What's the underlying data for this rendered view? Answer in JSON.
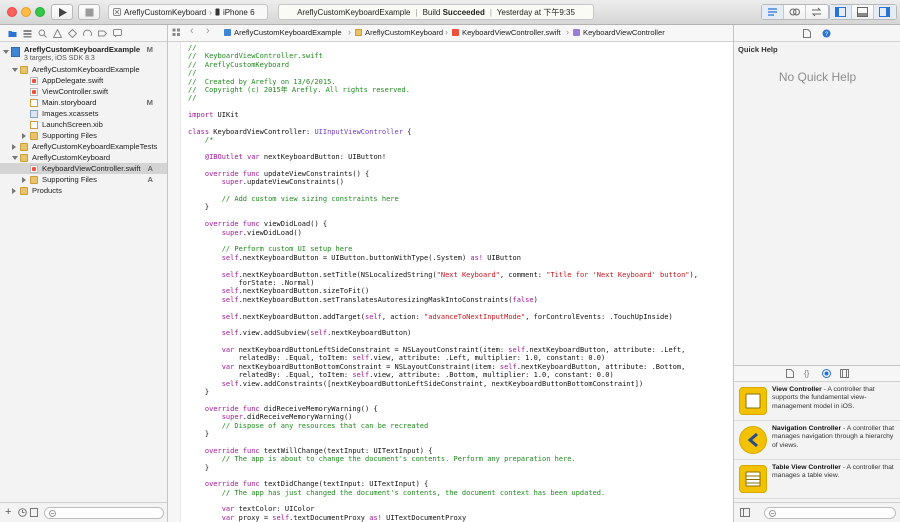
{
  "toolbar": {
    "scheme_target": "AreflyCustomKeyboard",
    "scheme_device": "iPhone 6",
    "status_project": "AreflyCustomKeyboardExample",
    "status_build_prefix": "Build",
    "status_build_result": "Succeeded",
    "status_time": "Yesterday at 下午9:35"
  },
  "navigator": {
    "project_name": "AreflyCustomKeyboardExample",
    "project_meta": "3 targets, iOS SDK 8.3",
    "project_badge": "M",
    "items": [
      {
        "label": "AreflyCustomKeyboardExample",
        "badge": ""
      },
      {
        "label": "AppDelegate.swift",
        "badge": ""
      },
      {
        "label": "ViewController.swift",
        "badge": ""
      },
      {
        "label": "Main.storyboard",
        "badge": "M"
      },
      {
        "label": "Images.xcassets",
        "badge": ""
      },
      {
        "label": "LaunchScreen.xib",
        "badge": ""
      },
      {
        "label": "Supporting Files",
        "badge": ""
      },
      {
        "label": "AreflyCustomKeyboardExampleTests",
        "badge": ""
      },
      {
        "label": "AreflyCustomKeyboard",
        "badge": ""
      },
      {
        "label": "KeyboardViewController.swift",
        "badge": "A"
      },
      {
        "label": "Supporting Files",
        "badge": "A"
      },
      {
        "label": "Products",
        "badge": ""
      }
    ]
  },
  "jumpbar": {
    "crumbs": [
      "AreflyCustomKeyboardExample",
      "AreflyCustomKeyboard",
      "KeyboardViewController.swift",
      "KeyboardViewController"
    ]
  },
  "code": {
    "lines": [
      [
        [
          "c",
          "//"
        ]
      ],
      [
        [
          "c",
          "//  KeyboardViewController.swift"
        ]
      ],
      [
        [
          "c",
          "//  AreflyCustomKeyboard"
        ]
      ],
      [
        [
          "c",
          "//"
        ]
      ],
      [
        [
          "c",
          "//  Created by Arefly on 13/6/2015."
        ]
      ],
      [
        [
          "c",
          "//  Copyright (c) 2015年 Arefly. All rights reserved."
        ]
      ],
      [
        [
          "c",
          "//"
        ]
      ],
      [
        [
          "p",
          ""
        ]
      ],
      [
        [
          "k",
          "import"
        ],
        [
          "p",
          " UIKit"
        ]
      ],
      [
        [
          "p",
          ""
        ]
      ],
      [
        [
          "k",
          "class"
        ],
        [
          "p",
          " KeyboardViewController: "
        ],
        [
          "t",
          "UIInputViewController"
        ],
        [
          "p",
          " {"
        ]
      ],
      [
        [
          "c",
          "    /*"
        ]
      ],
      [
        [
          "p",
          ""
        ]
      ],
      [
        [
          "k",
          "    @IBOutlet var"
        ],
        [
          "p",
          " nextKeyboardButton: UIButton!"
        ]
      ],
      [
        [
          "p",
          ""
        ]
      ],
      [
        [
          "k",
          "    override func"
        ],
        [
          "p",
          " updateViewConstraints() {"
        ]
      ],
      [
        [
          "k",
          "        super"
        ],
        [
          "p",
          ".updateViewConstraints()"
        ]
      ],
      [
        [
          "p",
          ""
        ]
      ],
      [
        [
          "c",
          "        // Add custom view sizing constraints here"
        ]
      ],
      [
        [
          "p",
          "    }"
        ]
      ],
      [
        [
          "p",
          ""
        ]
      ],
      [
        [
          "k",
          "    override func"
        ],
        [
          "p",
          " viewDidLoad() {"
        ]
      ],
      [
        [
          "k",
          "        super"
        ],
        [
          "p",
          ".viewDidLoad()"
        ]
      ],
      [
        [
          "p",
          ""
        ]
      ],
      [
        [
          "c",
          "        // Perform custom UI setup here"
        ]
      ],
      [
        [
          "k",
          "        self"
        ],
        [
          "p",
          ".nextKeyboardButton = UIButton.buttonWithType(.System) "
        ],
        [
          "k",
          "as!"
        ],
        [
          "p",
          " UIButton"
        ]
      ],
      [
        [
          "p",
          ""
        ]
      ],
      [
        [
          "k",
          "        self"
        ],
        [
          "p",
          ".nextKeyboardButton.setTitle(NSLocalizedString("
        ],
        [
          "s",
          "\"Next Keyboard\""
        ],
        [
          "p",
          ", comment: "
        ],
        [
          "s",
          "\"Title for 'Next Keyboard' button\""
        ],
        [
          "p",
          "),"
        ]
      ],
      [
        [
          "p",
          "            forState: .Normal)"
        ]
      ],
      [
        [
          "k",
          "        self"
        ],
        [
          "p",
          ".nextKeyboardButton.sizeToFit()"
        ]
      ],
      [
        [
          "k",
          "        self"
        ],
        [
          "p",
          ".nextKeyboardButton.setTranslatesAutoresizingMaskIntoConstraints("
        ],
        [
          "k",
          "false"
        ],
        [
          "p",
          ")"
        ]
      ],
      [
        [
          "p",
          ""
        ]
      ],
      [
        [
          "k",
          "        self"
        ],
        [
          "p",
          ".nextKeyboardButton.addTarget("
        ],
        [
          "k",
          "self"
        ],
        [
          "p",
          ", action: "
        ],
        [
          "s",
          "\"advanceToNextInputMode\""
        ],
        [
          "p",
          ", forControlEvents: .TouchUpInside)"
        ]
      ],
      [
        [
          "p",
          ""
        ]
      ],
      [
        [
          "k",
          "        self"
        ],
        [
          "p",
          ".view.addSubview("
        ],
        [
          "k",
          "self"
        ],
        [
          "p",
          ".nextKeyboardButton)"
        ]
      ],
      [
        [
          "p",
          ""
        ]
      ],
      [
        [
          "k",
          "        var"
        ],
        [
          "p",
          " nextKeyboardButtonLeftSideConstraint = NSLayoutConstraint(item: "
        ],
        [
          "k",
          "self"
        ],
        [
          "p",
          ".nextKeyboardButton, attribute: .Left,"
        ]
      ],
      [
        [
          "p",
          "            relatedBy: .Equal, toItem: "
        ],
        [
          "k",
          "self"
        ],
        [
          "p",
          ".view, attribute: .Left, multiplier: 1.0, constant: 0.0)"
        ]
      ],
      [
        [
          "k",
          "        var"
        ],
        [
          "p",
          " nextKeyboardButtonBottomConstraint = NSLayoutConstraint(item: "
        ],
        [
          "k",
          "self"
        ],
        [
          "p",
          ".nextKeyboardButton, attribute: .Bottom,"
        ]
      ],
      [
        [
          "p",
          "            relatedBy: .Equal, toItem: "
        ],
        [
          "k",
          "self"
        ],
        [
          "p",
          ".view, attribute: .Bottom, multiplier: 1.0, constant: 0.0)"
        ]
      ],
      [
        [
          "k",
          "        self"
        ],
        [
          "p",
          ".view.addConstraints([nextKeyboardButtonLeftSideConstraint, nextKeyboardButtonBottomConstraint])"
        ]
      ],
      [
        [
          "p",
          "    }"
        ]
      ],
      [
        [
          "p",
          ""
        ]
      ],
      [
        [
          "k",
          "    override func"
        ],
        [
          "p",
          " didReceiveMemoryWarning() {"
        ]
      ],
      [
        [
          "k",
          "        super"
        ],
        [
          "p",
          ".didReceiveMemoryWarning()"
        ]
      ],
      [
        [
          "c",
          "        // Dispose of any resources that can be recreated"
        ]
      ],
      [
        [
          "p",
          "    }"
        ]
      ],
      [
        [
          "p",
          ""
        ]
      ],
      [
        [
          "k",
          "    override func"
        ],
        [
          "p",
          " textWillChange(textInput: UITextInput) {"
        ]
      ],
      [
        [
          "c",
          "        // The app is about to change the document's contents. Perform any preparation here."
        ]
      ],
      [
        [
          "p",
          "    }"
        ]
      ],
      [
        [
          "p",
          ""
        ]
      ],
      [
        [
          "k",
          "    override func"
        ],
        [
          "p",
          " textDidChange(textInput: UITextInput) {"
        ]
      ],
      [
        [
          "c",
          "        // The app has just changed the document's contents, the document context has been updated."
        ]
      ],
      [
        [
          "p",
          ""
        ]
      ],
      [
        [
          "k",
          "        var"
        ],
        [
          "p",
          " textColor: UIColor"
        ]
      ],
      [
        [
          "k",
          "        var"
        ],
        [
          "p",
          " proxy = "
        ],
        [
          "k",
          "self"
        ],
        [
          "p",
          ".textDocumentProxy "
        ],
        [
          "k",
          "as!"
        ],
        [
          "p",
          " UITextDocumentProxy"
        ]
      ]
    ]
  },
  "utilities": {
    "quick_help_title": "Quick Help",
    "quick_help_empty": "No Quick Help",
    "library": [
      {
        "title": "View Controller",
        "desc": " - A controller that supports the fundamental view-management model in iOS."
      },
      {
        "title": "Navigation Controller",
        "desc": " - A controller that manages navigation through a hierarchy of views."
      },
      {
        "title": "Table View Controller",
        "desc": " - A controller that manages a table view."
      }
    ]
  },
  "colors": {
    "comment": "#1f8a1f",
    "keyword": "#a1189a",
    "type": "#6e3ec0",
    "string": "#c4151b",
    "library_icon": "#f2c200"
  }
}
